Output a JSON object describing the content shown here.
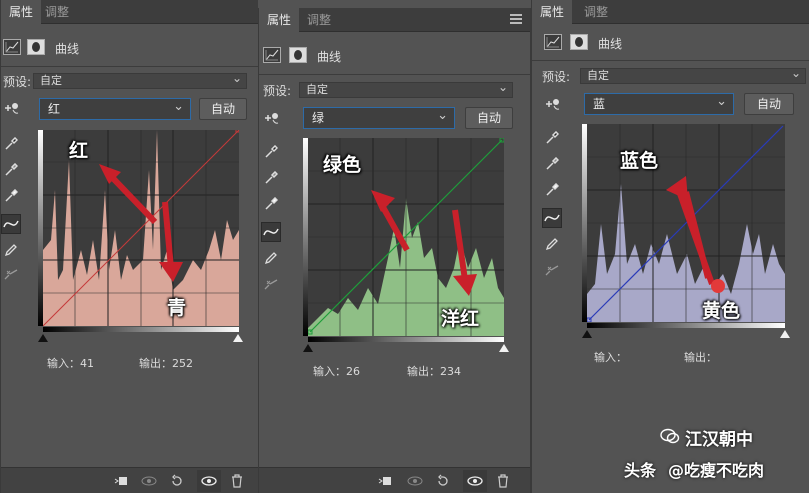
{
  "panels": [
    {
      "tabs": [
        "属性",
        "调整"
      ],
      "header_title": "曲线",
      "preset_label": "预设:",
      "preset_value": "自定",
      "channel": "红",
      "auto_label": "自动",
      "input_label": "输入：41",
      "output_label": "输出：252",
      "annotation_top": "红",
      "annotation_bottom": "青",
      "accent_color": "#d9a79a"
    },
    {
      "tabs": [
        "属性",
        "调整"
      ],
      "header_title": "曲线",
      "preset_label": "预设:",
      "preset_value": "自定",
      "channel": "绿",
      "auto_label": "自动",
      "input_label": "输入：26",
      "output_label": "输出：234",
      "annotation_top": "绿色",
      "annotation_bottom": "洋红",
      "accent_color": "#8fbf86"
    },
    {
      "tabs": [
        "属性",
        "调整"
      ],
      "header_title": "曲线",
      "preset_label": "预设:",
      "preset_value": "自定",
      "channel": "蓝",
      "auto_label": "自动",
      "input_label": "输入：",
      "output_label": "输出：",
      "annotation_top": "蓝色",
      "annotation_bottom": "黄色",
      "accent_color": "#a8a8c8"
    }
  ],
  "watermark": {
    "account": "江汉朝中",
    "platform": "头条",
    "handle": "@吃瘦不吃肉"
  }
}
